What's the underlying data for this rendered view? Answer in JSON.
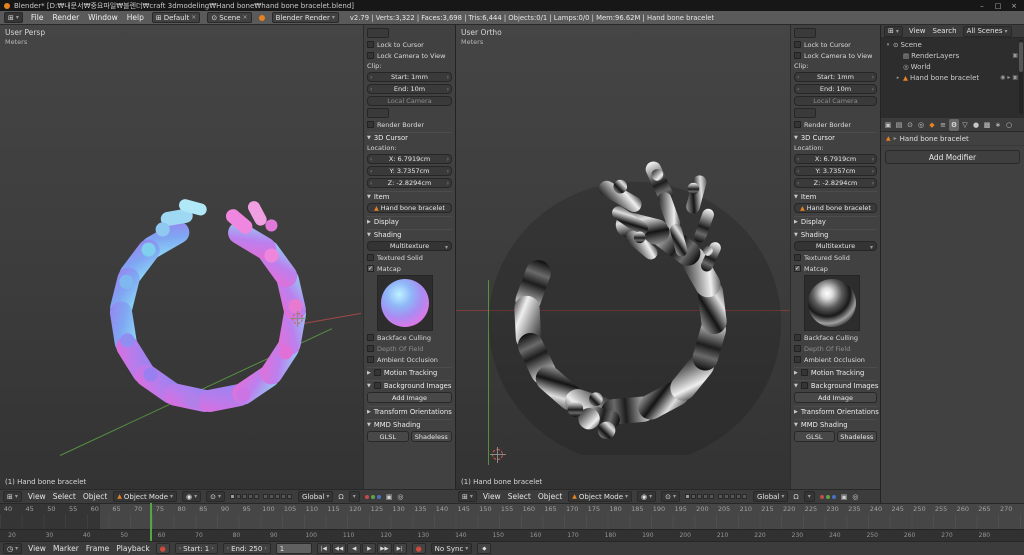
{
  "window": {
    "title": "Blender* [D:₩내문서₩중요파일₩블렌더₩craft 3dmodeling₩Hand bone₩hand bone bracelet.blend]",
    "minimize": "–",
    "maximize": "□",
    "close": "×"
  },
  "icons": {
    "editor": "⊞",
    "clock": "◷",
    "sphere": "◉",
    "pivot": "⊙",
    "magnet": "Ω",
    "camera": "▣",
    "globe": "◎",
    "mesh": "▲",
    "dropdown": "▾",
    "close": "×",
    "record": "●",
    "key": "◆",
    "check": "✓",
    "arrow-left": "‹",
    "arrow-right": "›",
    "panel-open": "▼",
    "panel-closed": "▶",
    "breadcrumb-arrow": "▸",
    "scene": "⊙"
  },
  "info_bar": {
    "menus": [
      "File",
      "Render",
      "Window",
      "Help"
    ],
    "layout_name": "Default",
    "scene_name": "Scene",
    "engine": "Blender Render",
    "stats": "v2.79 | Verts:3,322 | Faces:3,698 | Tris:6,444 | Objects:0/1 | Lamps:0/0 | Mem:96.62M | Hand bone bracelet"
  },
  "vp_header": {
    "menus": [
      "View",
      "Select",
      "Object"
    ],
    "mode": "Object Mode",
    "orientation": "Global"
  },
  "viewport_left": {
    "view_name": "User Persp",
    "unit": "Meters",
    "object_label": "(1) Hand bone bracelet"
  },
  "viewport_right": {
    "view_name": "User Ortho",
    "unit": "Meters",
    "object_label": "(1) Hand bone bracelet"
  },
  "n_panel": {
    "lock_to_cursor": "Lock to Cursor",
    "lock_camera_to_view": "Lock Camera to View",
    "clip_label": "Clip:",
    "clip_start": "Start: 1mm",
    "clip_end": "End: 10m",
    "local_camera": "Local Camera",
    "render_border": "Render Border",
    "cursor_header": "3D Cursor",
    "location_label": "Location:",
    "cursor_x": "X: 6.7919cm",
    "cursor_y": "Y: 3.7357cm",
    "cursor_z": "Z: -2.8294cm",
    "item_header": "Item",
    "item_name": "Hand bone bracelet",
    "display_header": "Display",
    "shading_header": "Shading",
    "shading_mode": "Multitexture",
    "textured_solid": "Textured Solid",
    "matcap": "Matcap",
    "backface_culling": "Backface Culling",
    "depth_of_field": "Depth Of Field",
    "ambient_occlusion": "Ambient Occlusion",
    "motion_tracking": "Motion Tracking",
    "background_images": "Background Images",
    "add_image": "Add Image",
    "transform_orientations": "Transform Orientations",
    "mmd_shading": "MMD Shading",
    "glsl": "GLSL",
    "shadeless": "Shadeless"
  },
  "outliner": {
    "menus": [
      "View",
      "Search"
    ],
    "scope": "All Scenes",
    "items": [
      {
        "label": "Scene",
        "depth": 0,
        "expander": "▾",
        "icon": "⊙",
        "icon_name": "scene-icon",
        "icon_color": "#cfcfcf",
        "trailing": []
      },
      {
        "label": "RenderLayers",
        "depth": 1,
        "expander": "",
        "icon": "▤",
        "icon_name": "renderlayers-icon",
        "icon_color": "#b5b5b5",
        "trailing": [
          "▣"
        ]
      },
      {
        "label": "World",
        "depth": 1,
        "expander": "",
        "icon": "◎",
        "icon_name": "world-icon",
        "icon_color": "#b5b5b5",
        "trailing": []
      },
      {
        "label": "Hand bone bracelet",
        "depth": 1,
        "expander": "▸",
        "icon": "▲",
        "icon_name": "mesh-object-icon",
        "icon_color": "#e8821e",
        "trailing": [
          "◉",
          "▸",
          "▣"
        ]
      }
    ]
  },
  "properties": {
    "tabs": [
      {
        "name": "render-tab",
        "glyph": "▣"
      },
      {
        "name": "render-layers-tab",
        "glyph": "▤"
      },
      {
        "name": "scene-tab",
        "glyph": "⊙"
      },
      {
        "name": "world-tab",
        "glyph": "◎"
      },
      {
        "name": "object-tab",
        "glyph": "◆",
        "color": "#e8821e"
      },
      {
        "name": "constraints-tab",
        "glyph": "≡"
      },
      {
        "name": "modifiers-tab",
        "glyph": "⚙",
        "active": true
      },
      {
        "name": "object-data-tab",
        "glyph": "▽"
      },
      {
        "name": "material-tab",
        "glyph": "●"
      },
      {
        "name": "texture-tab",
        "glyph": "▩"
      },
      {
        "name": "particles-tab",
        "glyph": "∗"
      },
      {
        "name": "physics-tab",
        "glyph": "○"
      }
    ],
    "context_name": "Hand bone bracelet",
    "add_modifier": "Add Modifier"
  },
  "timeline": {
    "menus": [
      "View",
      "Marker",
      "Frame",
      "Playback"
    ],
    "start": "Start: 1",
    "end": "End: 250",
    "current_frame": "1",
    "sync": "No Sync",
    "ruler_major": [
      40,
      45,
      50,
      55,
      60,
      65,
      70,
      75,
      80,
      85,
      90,
      95,
      100,
      105,
      110,
      115,
      120,
      125,
      130,
      135,
      140,
      145,
      150,
      155,
      160,
      165,
      170,
      175,
      180,
      185,
      190,
      195,
      200,
      205,
      210,
      215,
      220,
      225,
      230,
      235,
      240,
      245,
      250,
      255,
      260,
      265,
      270
    ],
    "ruler_minor": [
      20,
      30,
      40,
      50,
      60,
      70,
      80,
      90,
      100,
      110,
      120,
      130,
      140,
      150,
      160,
      170,
      180,
      190,
      200,
      210,
      220,
      230,
      240,
      250,
      260,
      270,
      280
    ],
    "playback": [
      {
        "name": "jump-to-start-button",
        "glyph": "|◀"
      },
      {
        "name": "prev-keyframe-button",
        "glyph": "◀◀"
      },
      {
        "name": "play-reverse-button",
        "glyph": "◀"
      },
      {
        "name": "play-button",
        "glyph": "▶"
      },
      {
        "name": "next-keyframe-button",
        "glyph": "▶▶"
      },
      {
        "name": "jump-to-end-button",
        "glyph": "▶|"
      }
    ]
  },
  "colors": {
    "accent_orange": "#e8821e",
    "axis_green": "#58a544",
    "axis_red": "#b04a4a",
    "frame_line_green": "#58a544"
  }
}
